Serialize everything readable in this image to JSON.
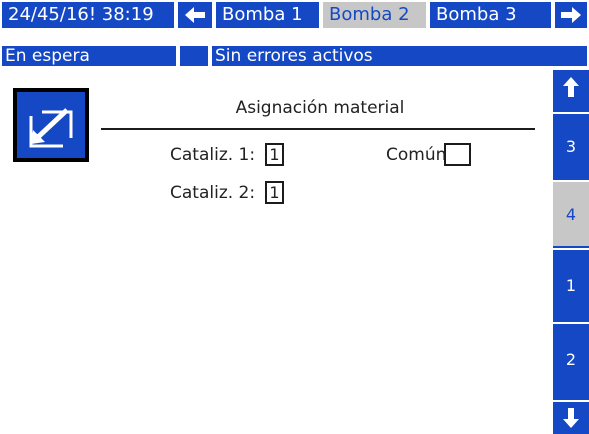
{
  "header": {
    "datetime": "24/45/16! 38:19",
    "pump_tabs": [
      {
        "label": "Bomba 1",
        "selected": false
      },
      {
        "label": "Bomba 2",
        "selected": true
      },
      {
        "label": "Bomba 3",
        "selected": false
      }
    ],
    "left_arrow_icon": "arrow-left-icon",
    "right_arrow_icon": "arrow-right-icon"
  },
  "status": {
    "mode": "En espera",
    "indicator": "",
    "errors": "Sin errores activos"
  },
  "screen": {
    "icon": "edit-setup-icon",
    "title": "Asignación material",
    "fields": {
      "catalyst1_label": "Cataliz. 1:",
      "catalyst1_value": "1",
      "common_label": "Común:",
      "common_value": "",
      "catalyst2_label": "Cataliz. 2:",
      "catalyst2_value": "1"
    }
  },
  "side_nav": {
    "up_icon": "arrow-up-icon",
    "down_icon": "arrow-down-icon",
    "pages": [
      {
        "label": "3",
        "selected": false
      },
      {
        "label": "4",
        "selected": true
      },
      {
        "label": "1",
        "selected": false
      },
      {
        "label": "2",
        "selected": false
      }
    ]
  },
  "colors": {
    "accent": "#1548c4",
    "selected_bg": "#c7c7c7",
    "text": "#222222",
    "background": "#ffffff"
  }
}
